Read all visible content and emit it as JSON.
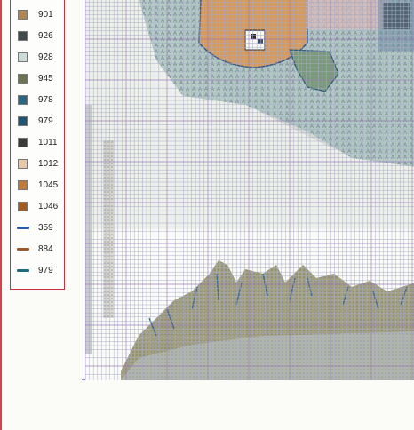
{
  "legend": {
    "items": [
      {
        "label": "901",
        "kind": "swatch",
        "color": "#b08555",
        "icon": "solid-square"
      },
      {
        "label": "926",
        "kind": "swatch",
        "color": "#3e4a4c",
        "icon": "dot-grid"
      },
      {
        "label": "928",
        "kind": "swatch",
        "color": "#c9dcd8",
        "icon": "light-grid"
      },
      {
        "label": "945",
        "kind": "swatch",
        "color": "#6b7452",
        "icon": "framed-square"
      },
      {
        "label": "978",
        "kind": "swatch",
        "color": "#2b6580",
        "icon": "solid-square"
      },
      {
        "label": "979",
        "kind": "swatch",
        "color": "#1f5570",
        "icon": "solid-square"
      },
      {
        "label": "1011",
        "kind": "swatch",
        "color": "#3a3a3a",
        "icon": "two-dots"
      },
      {
        "label": "1012",
        "kind": "swatch",
        "color": "#e8c8a8",
        "icon": "corner-dots"
      },
      {
        "label": "1045",
        "kind": "swatch",
        "color": "#c07a3a",
        "icon": "solid-square"
      },
      {
        "label": "1046",
        "kind": "swatch",
        "color": "#a05a22",
        "icon": "cross-dots"
      },
      {
        "label": "359",
        "kind": "line",
        "color": "#2a5aa8",
        "icon": "backstitch-line"
      },
      {
        "label": "884",
        "kind": "line",
        "color": "#9a5a2a",
        "icon": "backstitch-line"
      },
      {
        "label": "979",
        "kind": "line",
        "color": "#1f6a80",
        "icon": "backstitch-line"
      }
    ]
  },
  "colors": {
    "legend_border": "#c8343c",
    "grid_line": "#9fa3c4",
    "grid_major": "#8a6ab0",
    "pumpkin": "#d49a5e",
    "pumpkin_dark": "#7a4a20",
    "sky_grey": "#d0d6d0",
    "foliage_teal": "#8fb8b2",
    "grass_green": "#7f8a5a",
    "ground_grey": "#b9bfb7"
  }
}
